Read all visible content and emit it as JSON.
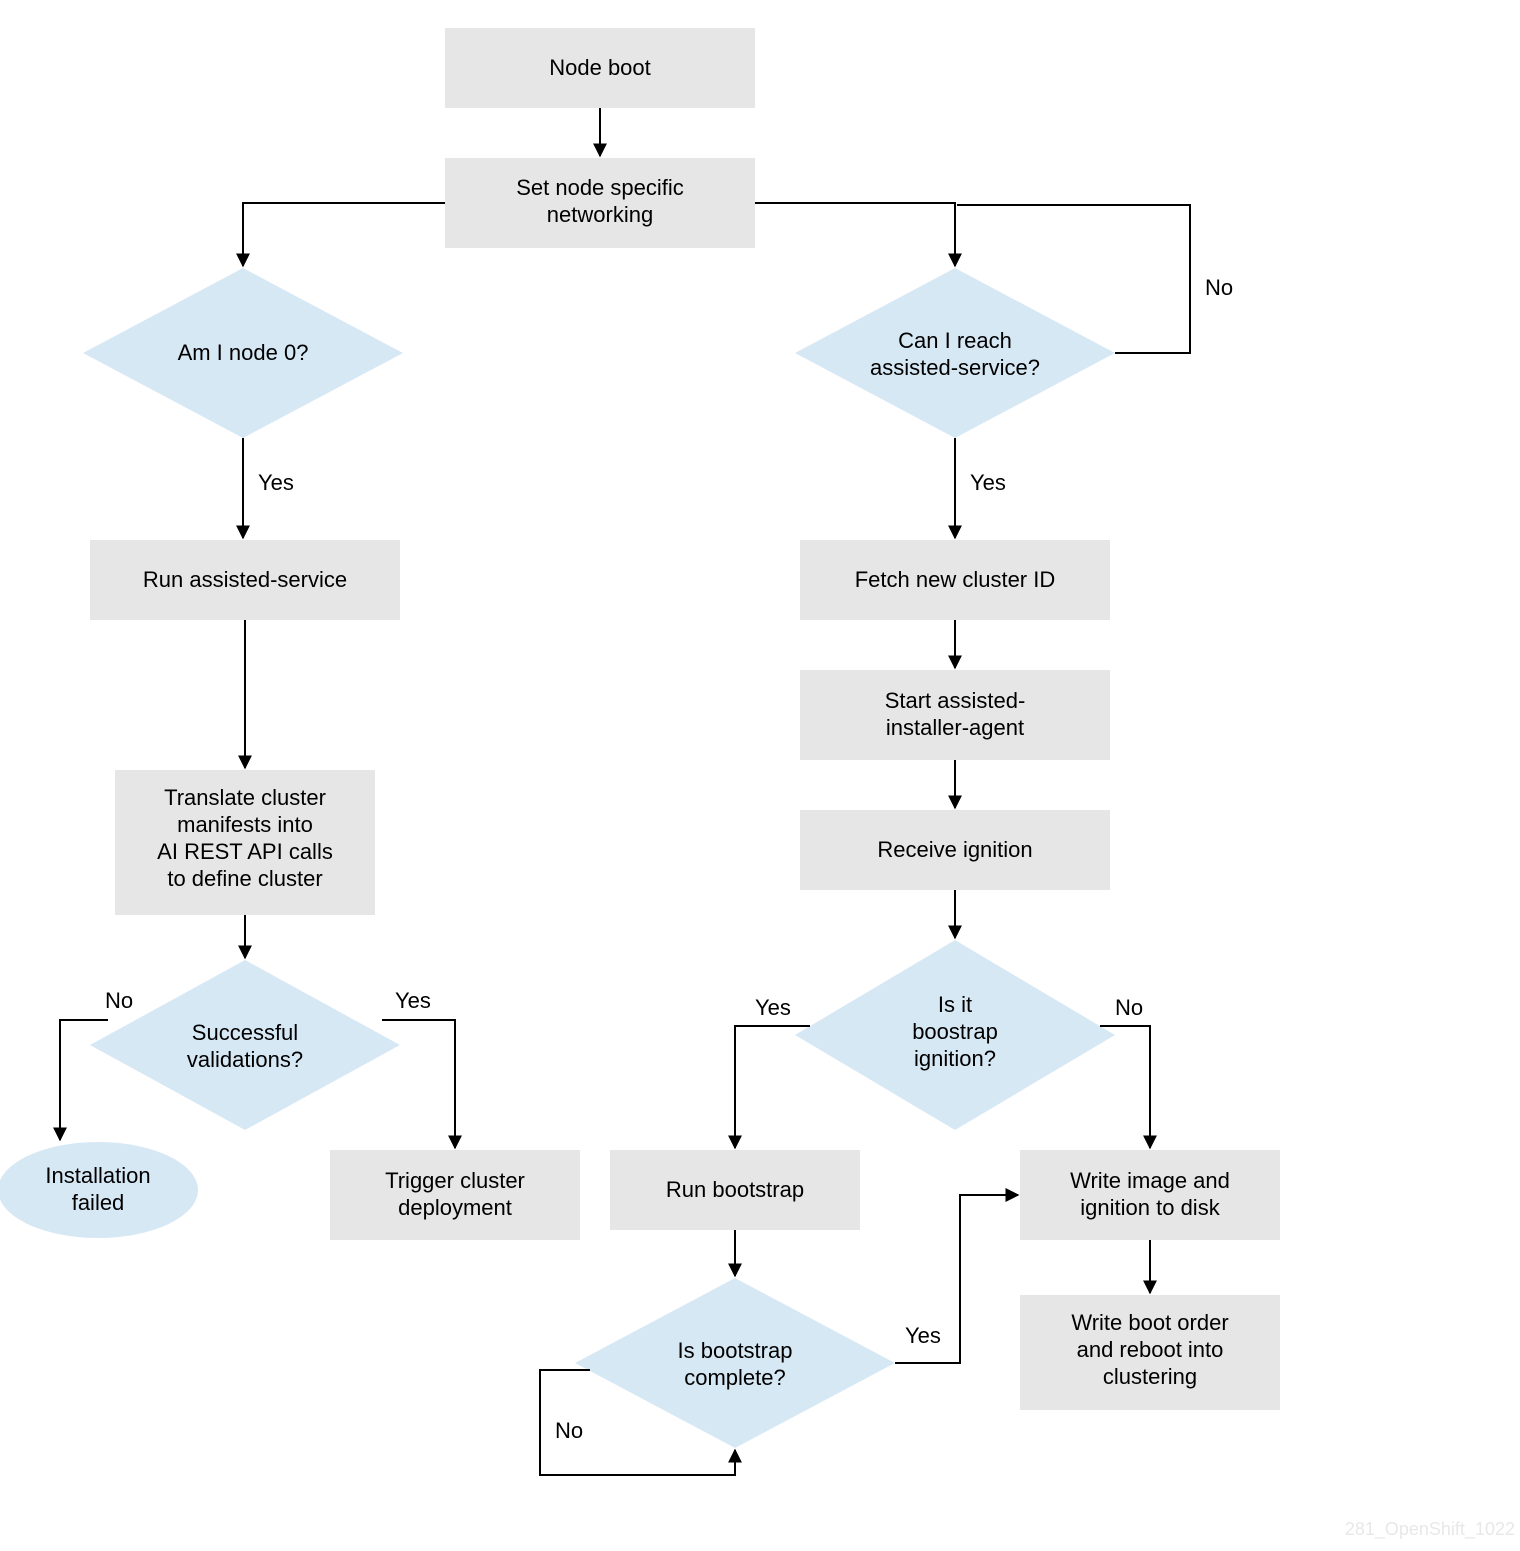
{
  "nodes": {
    "node_boot": "Node boot",
    "set_networking_l1": "Set node specific",
    "set_networking_l2": "networking",
    "am_node0": "Am I node 0?",
    "can_reach_l1": "Can I reach",
    "can_reach_l2": "assisted-service?",
    "run_assisted": "Run assisted-service",
    "translate_l1": "Translate cluster",
    "translate_l2": "manifests into",
    "translate_l3": "AI REST API calls",
    "translate_l4": "to define cluster",
    "succ_valid_l1": "Successful",
    "succ_valid_l2": "validations?",
    "install_failed_l1": "Installation",
    "install_failed_l2": "failed",
    "trigger_l1": "Trigger cluster",
    "trigger_l2": "deployment",
    "fetch_cluster": "Fetch new cluster ID",
    "start_agent_l1": "Start assisted-",
    "start_agent_l2": "installer-agent",
    "receive_ignition": "Receive ignition",
    "is_bootstrap_l1": "Is it",
    "is_bootstrap_l2": "boostrap",
    "is_bootstrap_l3": "ignition?",
    "run_bootstrap": "Run bootstrap",
    "bootstrap_complete_l1": "Is bootstrap",
    "bootstrap_complete_l2": "complete?",
    "write_image_l1": "Write image and",
    "write_image_l2": "ignition to disk",
    "write_boot_l1": "Write boot order",
    "write_boot_l2": "and reboot into",
    "write_boot_l3": "clustering"
  },
  "labels": {
    "yes": "Yes",
    "no": "No"
  },
  "watermark": "281_OpenShift_1022"
}
